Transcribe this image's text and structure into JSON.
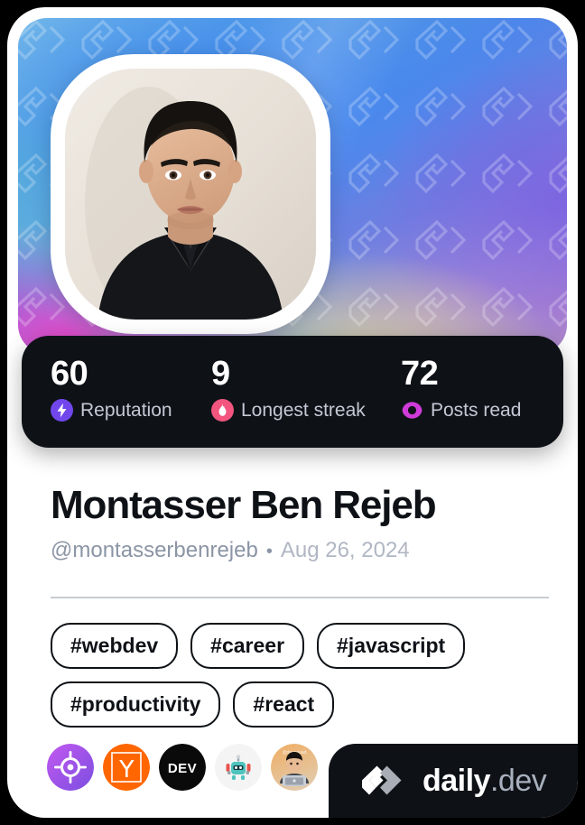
{
  "card": {
    "type": "devcard",
    "accent_colors": {
      "stats_background": "#0e1217",
      "reputation": "#7147ed",
      "streak": "#f3557f",
      "posts_read": "#cf3bd9",
      "text_dark": "#0e1217",
      "muted": "#8b95a5"
    }
  },
  "cover": {
    "pattern_icon": "daily-dev-logo-watermark",
    "gradient_from": "#7fc4e8",
    "gradient_to": "#b87fc7"
  },
  "avatar": {
    "alt": "Montasser Ben Rejeb profile photo",
    "icon": "user-avatar"
  },
  "stats": [
    {
      "value": "60",
      "label": "Reputation",
      "icon": "bolt-icon",
      "color": "#7147ed"
    },
    {
      "value": "9",
      "label": "Longest streak",
      "icon": "flame-icon",
      "color": "#f3557f"
    },
    {
      "value": "72",
      "label": "Posts read",
      "icon": "eye-ring-icon",
      "color": "#cf3bd9"
    }
  ],
  "identity": {
    "name": "Montasser Ben Rejeb",
    "handle": "@montasserbenrejeb",
    "separator": "•",
    "date": "Aug 26, 2024"
  },
  "tags": [
    "#webdev",
    "#career",
    "#javascript",
    "#productivity",
    "#react"
  ],
  "sources": [
    {
      "name": "target-crosshair-source",
      "label": "Crosshair"
    },
    {
      "name": "ycombinator-source",
      "label": "Y"
    },
    {
      "name": "devto-source",
      "label": "DEV"
    },
    {
      "name": "robot-emoji-source",
      "label": "Robot"
    },
    {
      "name": "user-avatar-source",
      "label": "Avatar"
    }
  ],
  "brand": {
    "mark": "daily-dev-logo",
    "name": "daily",
    "tld": ".dev"
  }
}
